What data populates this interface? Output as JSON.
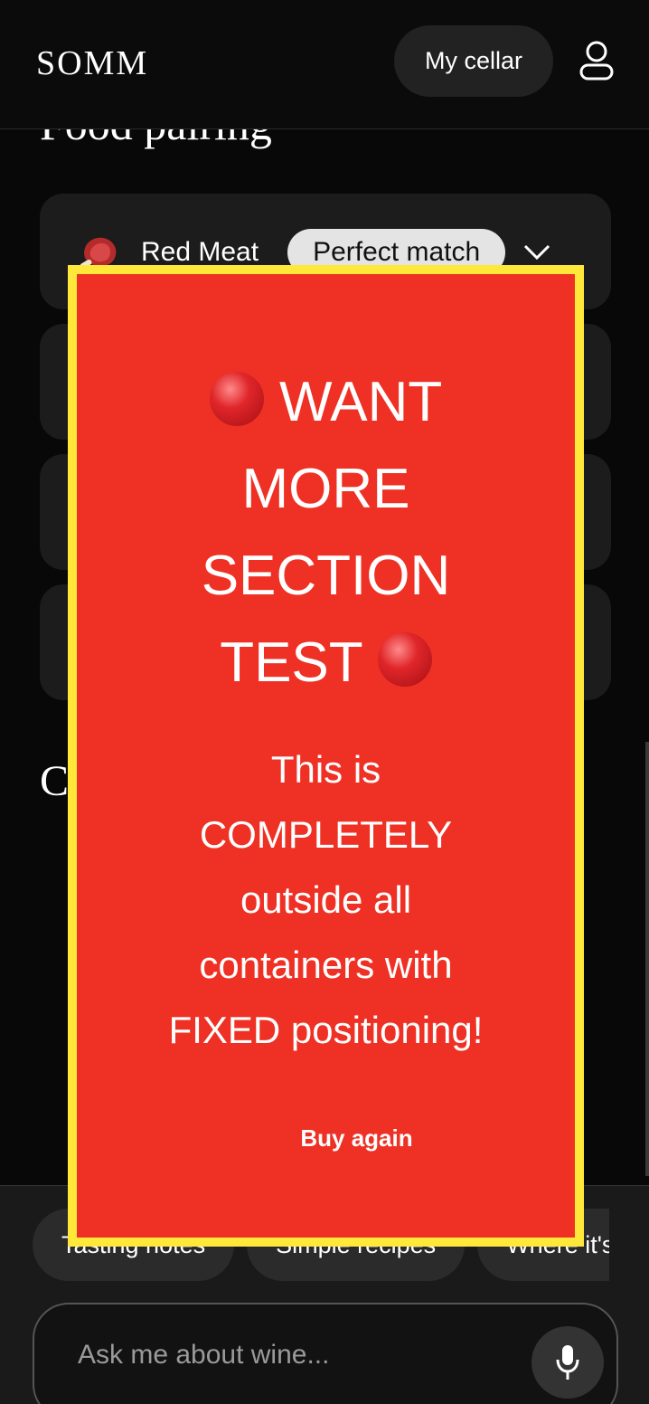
{
  "header": {
    "logo": "SOMM",
    "cellar_label": "My cellar",
    "user_icon": "user-icon"
  },
  "content": {
    "section_title": "Food pairing",
    "pairing": {
      "icon": "steak-icon",
      "label": "Red Meat",
      "badge": "Perfect match",
      "chevron": "chevron-down-icon"
    },
    "next_section_initial": "C"
  },
  "overlay": {
    "title_line1": "WANT",
    "title_line2": "MORE",
    "title_line3": "SECTION",
    "title_line4": "TEST",
    "body_line1": "This is",
    "body_line2": "COMPLETELY",
    "body_line3": "outside all",
    "body_line4": "containers with",
    "body_line5": "FIXED positioning!",
    "button": "Buy again",
    "colors": {
      "background": "#ee3124",
      "border": "#ffe83a"
    }
  },
  "chips": [
    "Tasting notes",
    "Simple recipes",
    "Where it's"
  ],
  "ask": {
    "placeholder": "Ask me about wine...",
    "mic_icon": "microphone-icon"
  }
}
